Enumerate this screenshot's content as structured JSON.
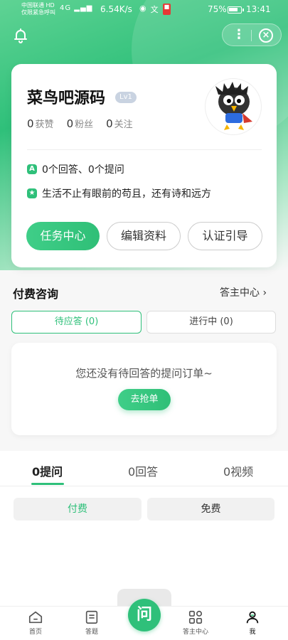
{
  "status_bar": {
    "carrier_line1": "中国联通 HD",
    "carrier_line2": "仅限紧急呼叫",
    "signal": "4G",
    "net_speed": "6.54K/s",
    "battery": "75%",
    "time": "13:41"
  },
  "header": {
    "bell_icon": "bell-icon",
    "more_icon": "more-vertical-icon",
    "close_icon": "close-circle-icon"
  },
  "profile": {
    "name": "菜鸟吧源码",
    "level": "Lv1",
    "stats": [
      {
        "count": "0",
        "label": "获赞"
      },
      {
        "count": "0",
        "label": "粉丝"
      },
      {
        "count": "0",
        "label": "关注"
      }
    ],
    "qa_summary": "0个回答、0个提问",
    "signature": "生活不止有眼前的苟且，还有诗和远方",
    "buttons": {
      "task_center": "任务中心",
      "edit_profile": "编辑资料",
      "cert_guide": "认证引导"
    }
  },
  "paid_consult": {
    "title": "付费咨询",
    "link": "答主中心",
    "segments": {
      "pending": "待应答 (0)",
      "in_progress": "进行中 (0)"
    },
    "empty_text": "您还没有待回答的提问订单~",
    "grab_button": "去抢单"
  },
  "content_tabs": {
    "questions": "0提问",
    "answers": "0回答",
    "videos": "0视频",
    "paid": "付费",
    "free": "免费"
  },
  "bottom_nav": {
    "home": "首页",
    "answer": "答题",
    "center_button": "问",
    "host_center": "答主中心",
    "me": "我"
  },
  "colors": {
    "accent": "#2fc07a",
    "level_badge": "#c9d3e1"
  }
}
